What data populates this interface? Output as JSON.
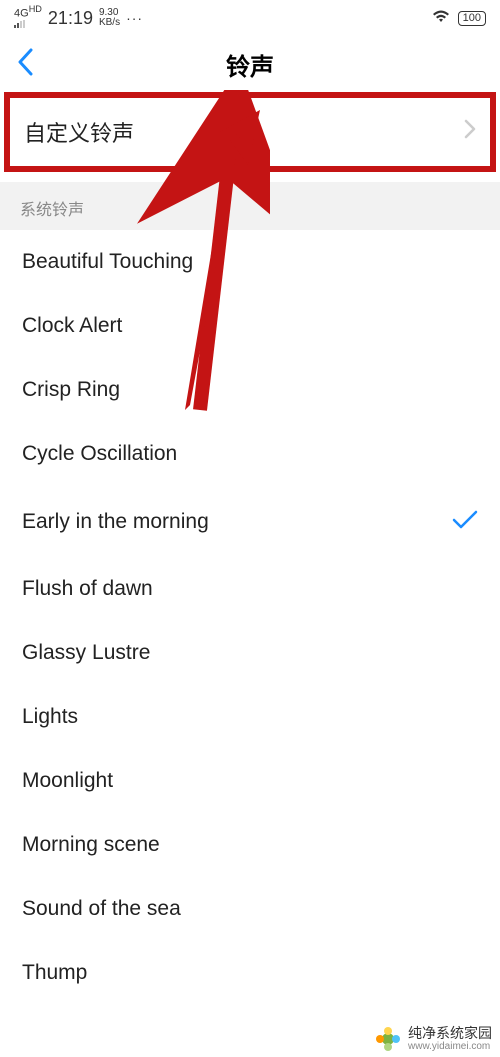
{
  "statusBar": {
    "network": "4G",
    "networkSup": "HD",
    "time": "21:19",
    "speed1": "9.30",
    "speed2": "KB/s",
    "dots": "···",
    "battery": "100"
  },
  "header": {
    "title": "铃声"
  },
  "customRingtone": {
    "label": "自定义铃声"
  },
  "sectionHeader": "系统铃声",
  "ringtones": [
    {
      "name": "Beautiful Touching",
      "selected": false
    },
    {
      "name": "Clock Alert",
      "selected": false
    },
    {
      "name": "Crisp Ring",
      "selected": false
    },
    {
      "name": "Cycle Oscillation",
      "selected": false
    },
    {
      "name": "Early in the morning",
      "selected": true
    },
    {
      "name": "Flush of dawn",
      "selected": false
    },
    {
      "name": "Glassy Lustre",
      "selected": false
    },
    {
      "name": "Lights",
      "selected": false
    },
    {
      "name": "Moonlight",
      "selected": false
    },
    {
      "name": "Morning scene",
      "selected": false
    },
    {
      "name": "Sound of the sea",
      "selected": false
    },
    {
      "name": "Thump",
      "selected": false
    }
  ],
  "watermark": {
    "zh": "纯净系统家园",
    "url": "www.yidaimei.com"
  }
}
